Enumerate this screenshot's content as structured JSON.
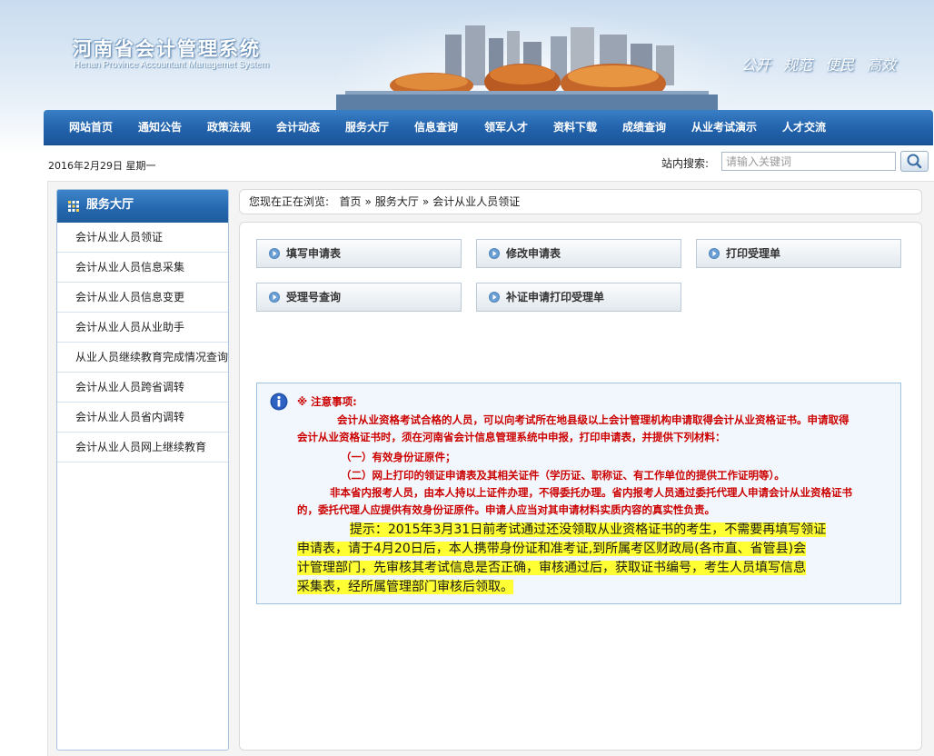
{
  "site": {
    "title_cn": "河南省会计管理系统",
    "title_en": "Henan  Province Accountant Managemet System",
    "slogans": [
      "公开",
      "规范",
      "便民",
      "高效"
    ]
  },
  "nav": {
    "items": [
      "网站首页",
      "通知公告",
      "政策法规",
      "会计动态",
      "服务大厅",
      "信息查询",
      "领军人才",
      "资料下载",
      "成绩查询",
      "从业考试演示",
      "人才交流"
    ]
  },
  "topbar": {
    "date": "2016年2月29日  星期一",
    "search_label": "站内搜索:",
    "search_placeholder": "请输入关键词"
  },
  "sidebar": {
    "title": "服务大厅",
    "items": [
      "会计从业人员领证",
      "会计从业人员信息采集",
      "会计从业人员信息变更",
      "会计从业人员从业助手",
      "从业人员继续教育完成情况查询",
      "会计从业人员跨省调转",
      "会计从业人员省内调转",
      "会计从业人员网上继续教育"
    ]
  },
  "breadcrumb": {
    "prefix": "您现在正在浏览:",
    "items": [
      "首页",
      "服务大厅",
      "会计从业人员领证"
    ],
    "separator": "»"
  },
  "actions": [
    "填写申请表",
    "修改申请表",
    "打印受理单",
    "受理号查询",
    "补证申请打印受理单"
  ],
  "notice": {
    "heading": "※   注意事项:",
    "para1_line1": "会计从业资格考试合格的人员，可以向考试所在地县级以上会计管理机构申请取得会计从业资格证书。申请取得",
    "para1_line2": "会计从业资格证书时，须在河南省会计信息管理系统中申报，打印申请表，并提供下列材料：",
    "item1": "（一）有效身份证原件；",
    "item2": "（二）网上打印的领证申请表及其相关证件（学历证、职称证、有工作单位的提供工作证明等）。",
    "para2_line1": "非本省内报考人员，由本人持以上证件办理，不得委托办理。省内报考人员通过委托代理人申请会计从业资格证书",
    "para2_line2": "的，委托代理人应提供有效身份证原件。申请人应当对其申请材料实质内容的真实性负责。",
    "tip_line1": "提示：2015年3月31日前考试通过还没领取从业资格证书的考生，不需要再填写领证",
    "tip_line2": "申请表，请于4月20日后，本人携带身份证和准考证,到所属考区财政局(各市直、省管县)会",
    "tip_line3": "计管理部门，先审核其考试信息是否正确，审核通过后，获取证书编号，考生人员填写信息",
    "tip_line4": "采集表，经所属管理部门审核后领取。"
  },
  "colors": {
    "nav_blue": "#2364ad",
    "notice_red": "#cc0000",
    "highlight": "#ffff33"
  }
}
